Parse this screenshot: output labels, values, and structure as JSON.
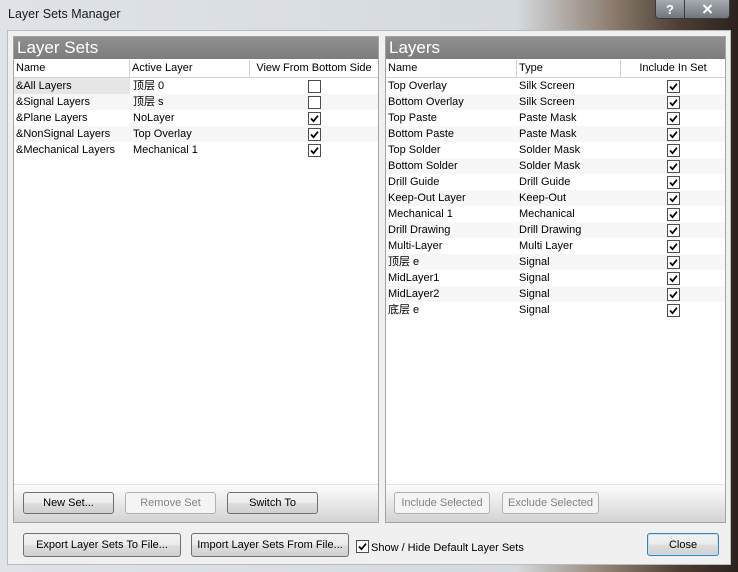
{
  "window": {
    "title": "Layer Sets Manager",
    "help_glyph": "?"
  },
  "theme": {
    "panel_header": "#7d7d7d",
    "default_button_border": "#3c7fb1",
    "client_background": "#f0f0f0"
  },
  "layer_sets": {
    "title": "Layer Sets",
    "columns": {
      "name": "Name",
      "active_layer": "Active Layer",
      "view_from_bottom": "View From Bottom Side"
    },
    "selected_index": 0,
    "rows": [
      {
        "name": "&All Layers",
        "active_layer": "顶层 0",
        "view_from_bottom": false
      },
      {
        "name": "&Signal Layers",
        "active_layer": "顶层 s",
        "view_from_bottom": false
      },
      {
        "name": "&Plane Layers",
        "active_layer": "NoLayer",
        "view_from_bottom": true
      },
      {
        "name": "&NonSignal Layers",
        "active_layer": "Top Overlay",
        "view_from_bottom": true
      },
      {
        "name": "&Mechanical Layers",
        "active_layer": "Mechanical 1",
        "view_from_bottom": true
      }
    ],
    "buttons": {
      "new_set": {
        "label": "New Set...",
        "enabled": true
      },
      "remove_set": {
        "label": "Remove Set",
        "enabled": false
      },
      "switch_to": {
        "label": "Switch To",
        "enabled": true
      }
    }
  },
  "layers": {
    "title": "Layers",
    "columns": {
      "name": "Name",
      "type": "Type",
      "include_in_set": "Include In Set"
    },
    "rows": [
      {
        "name": "Top Overlay",
        "type": "Silk Screen",
        "include_in_set": true
      },
      {
        "name": "Bottom Overlay",
        "type": "Silk Screen",
        "include_in_set": true
      },
      {
        "name": "Top Paste",
        "type": "Paste Mask",
        "include_in_set": true
      },
      {
        "name": "Bottom Paste",
        "type": "Paste Mask",
        "include_in_set": true
      },
      {
        "name": "Top Solder",
        "type": "Solder Mask",
        "include_in_set": true
      },
      {
        "name": "Bottom Solder",
        "type": "Solder Mask",
        "include_in_set": true
      },
      {
        "name": "Drill Guide",
        "type": "Drill Guide",
        "include_in_set": true
      },
      {
        "name": "Keep-Out Layer",
        "type": "Keep-Out",
        "include_in_set": true
      },
      {
        "name": "Mechanical 1",
        "type": "Mechanical",
        "include_in_set": true
      },
      {
        "name": "Drill Drawing",
        "type": "Drill Drawing",
        "include_in_set": true
      },
      {
        "name": "Multi-Layer",
        "type": "Multi Layer",
        "include_in_set": true
      },
      {
        "name": "顶层 e",
        "type": "Signal",
        "include_in_set": true
      },
      {
        "name": "MidLayer1",
        "type": "Signal",
        "include_in_set": true
      },
      {
        "name": "MidLayer2",
        "type": "Signal",
        "include_in_set": true
      },
      {
        "name": "底层 e",
        "type": "Signal",
        "include_in_set": true
      }
    ],
    "buttons": {
      "include_selected": {
        "label": "Include Selected",
        "enabled": false
      },
      "exclude_selected": {
        "label": "Exclude Selected",
        "enabled": false
      }
    }
  },
  "footer": {
    "export": {
      "label": "Export Layer Sets To File...",
      "enabled": true
    },
    "import": {
      "label": "Import Layer Sets From File...",
      "enabled": true
    },
    "show_hide_default": {
      "label": "Show / Hide Default Layer Sets",
      "checked": true
    },
    "close": {
      "label": "Close",
      "enabled": true,
      "is_default": true
    }
  }
}
